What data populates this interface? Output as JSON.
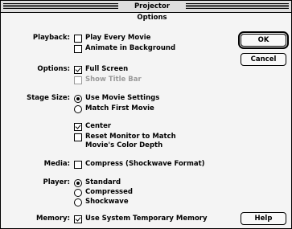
{
  "window": {
    "title": "Projector Options"
  },
  "playback": {
    "label": "Playback:",
    "play_every_movie": {
      "label": "Play Every Movie",
      "checked": false
    },
    "animate_in_background": {
      "label": "Animate in Background",
      "checked": false
    }
  },
  "options": {
    "label": "Options:",
    "full_screen": {
      "label": "Full Screen",
      "checked": true
    },
    "show_title_bar": {
      "label": "Show Title Bar",
      "checked": false,
      "disabled": true
    }
  },
  "stage_size": {
    "label": "Stage Size:",
    "use_movie_settings": {
      "label": "Use Movie Settings",
      "selected": true
    },
    "match_first_movie": {
      "label": "Match First Movie",
      "selected": false
    },
    "center": {
      "label": "Center",
      "checked": true
    },
    "reset_monitor": {
      "label_line1": "Reset Monitor to Match",
      "label_line2": "Movie's Color Depth",
      "checked": false
    }
  },
  "media": {
    "label": "Media:",
    "compress": {
      "label": "Compress (Shockwave Format)",
      "checked": false
    }
  },
  "player": {
    "label": "Player:",
    "standard": {
      "label": "Standard",
      "selected": true
    },
    "compressed": {
      "label": "Compressed",
      "selected": false
    },
    "shockwave": {
      "label": "Shockwave",
      "selected": false
    }
  },
  "memory": {
    "label": "Memory:",
    "use_system_temp": {
      "label": "Use System Temporary Memory",
      "checked": true
    }
  },
  "buttons": {
    "ok": "OK",
    "cancel": "Cancel",
    "help": "Help"
  }
}
